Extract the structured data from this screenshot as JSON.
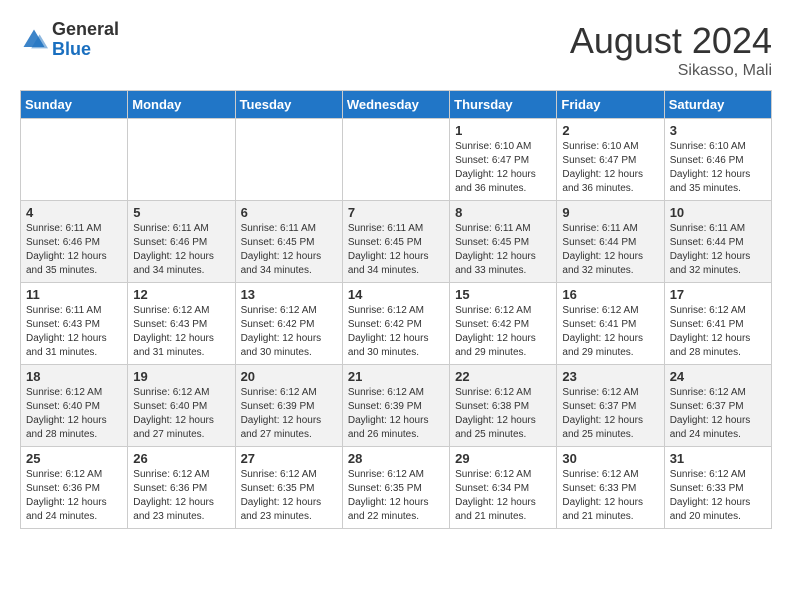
{
  "header": {
    "logo_general": "General",
    "logo_blue": "Blue",
    "month_year": "August 2024",
    "location": "Sikasso, Mali"
  },
  "days_of_week": [
    "Sunday",
    "Monday",
    "Tuesday",
    "Wednesday",
    "Thursday",
    "Friday",
    "Saturday"
  ],
  "weeks": [
    [
      {
        "day": "",
        "sunrise": "",
        "sunset": "",
        "daylight": ""
      },
      {
        "day": "",
        "sunrise": "",
        "sunset": "",
        "daylight": ""
      },
      {
        "day": "",
        "sunrise": "",
        "sunset": "",
        "daylight": ""
      },
      {
        "day": "",
        "sunrise": "",
        "sunset": "",
        "daylight": ""
      },
      {
        "day": "1",
        "sunrise": "6:10 AM",
        "sunset": "6:47 PM",
        "daylight": "12 hours and 36 minutes."
      },
      {
        "day": "2",
        "sunrise": "6:10 AM",
        "sunset": "6:47 PM",
        "daylight": "12 hours and 36 minutes."
      },
      {
        "day": "3",
        "sunrise": "6:10 AM",
        "sunset": "6:46 PM",
        "daylight": "12 hours and 35 minutes."
      }
    ],
    [
      {
        "day": "4",
        "sunrise": "6:11 AM",
        "sunset": "6:46 PM",
        "daylight": "12 hours and 35 minutes."
      },
      {
        "day": "5",
        "sunrise": "6:11 AM",
        "sunset": "6:46 PM",
        "daylight": "12 hours and 34 minutes."
      },
      {
        "day": "6",
        "sunrise": "6:11 AM",
        "sunset": "6:45 PM",
        "daylight": "12 hours and 34 minutes."
      },
      {
        "day": "7",
        "sunrise": "6:11 AM",
        "sunset": "6:45 PM",
        "daylight": "12 hours and 34 minutes."
      },
      {
        "day": "8",
        "sunrise": "6:11 AM",
        "sunset": "6:45 PM",
        "daylight": "12 hours and 33 minutes."
      },
      {
        "day": "9",
        "sunrise": "6:11 AM",
        "sunset": "6:44 PM",
        "daylight": "12 hours and 32 minutes."
      },
      {
        "day": "10",
        "sunrise": "6:11 AM",
        "sunset": "6:44 PM",
        "daylight": "12 hours and 32 minutes."
      }
    ],
    [
      {
        "day": "11",
        "sunrise": "6:11 AM",
        "sunset": "6:43 PM",
        "daylight": "12 hours and 31 minutes."
      },
      {
        "day": "12",
        "sunrise": "6:12 AM",
        "sunset": "6:43 PM",
        "daylight": "12 hours and 31 minutes."
      },
      {
        "day": "13",
        "sunrise": "6:12 AM",
        "sunset": "6:42 PM",
        "daylight": "12 hours and 30 minutes."
      },
      {
        "day": "14",
        "sunrise": "6:12 AM",
        "sunset": "6:42 PM",
        "daylight": "12 hours and 30 minutes."
      },
      {
        "day": "15",
        "sunrise": "6:12 AM",
        "sunset": "6:42 PM",
        "daylight": "12 hours and 29 minutes."
      },
      {
        "day": "16",
        "sunrise": "6:12 AM",
        "sunset": "6:41 PM",
        "daylight": "12 hours and 29 minutes."
      },
      {
        "day": "17",
        "sunrise": "6:12 AM",
        "sunset": "6:41 PM",
        "daylight": "12 hours and 28 minutes."
      }
    ],
    [
      {
        "day": "18",
        "sunrise": "6:12 AM",
        "sunset": "6:40 PM",
        "daylight": "12 hours and 28 minutes."
      },
      {
        "day": "19",
        "sunrise": "6:12 AM",
        "sunset": "6:40 PM",
        "daylight": "12 hours and 27 minutes."
      },
      {
        "day": "20",
        "sunrise": "6:12 AM",
        "sunset": "6:39 PM",
        "daylight": "12 hours and 27 minutes."
      },
      {
        "day": "21",
        "sunrise": "6:12 AM",
        "sunset": "6:39 PM",
        "daylight": "12 hours and 26 minutes."
      },
      {
        "day": "22",
        "sunrise": "6:12 AM",
        "sunset": "6:38 PM",
        "daylight": "12 hours and 25 minutes."
      },
      {
        "day": "23",
        "sunrise": "6:12 AM",
        "sunset": "6:37 PM",
        "daylight": "12 hours and 25 minutes."
      },
      {
        "day": "24",
        "sunrise": "6:12 AM",
        "sunset": "6:37 PM",
        "daylight": "12 hours and 24 minutes."
      }
    ],
    [
      {
        "day": "25",
        "sunrise": "6:12 AM",
        "sunset": "6:36 PM",
        "daylight": "12 hours and 24 minutes."
      },
      {
        "day": "26",
        "sunrise": "6:12 AM",
        "sunset": "6:36 PM",
        "daylight": "12 hours and 23 minutes."
      },
      {
        "day": "27",
        "sunrise": "6:12 AM",
        "sunset": "6:35 PM",
        "daylight": "12 hours and 23 minutes."
      },
      {
        "day": "28",
        "sunrise": "6:12 AM",
        "sunset": "6:35 PM",
        "daylight": "12 hours and 22 minutes."
      },
      {
        "day": "29",
        "sunrise": "6:12 AM",
        "sunset": "6:34 PM",
        "daylight": "12 hours and 21 minutes."
      },
      {
        "day": "30",
        "sunrise": "6:12 AM",
        "sunset": "6:33 PM",
        "daylight": "12 hours and 21 minutes."
      },
      {
        "day": "31",
        "sunrise": "6:12 AM",
        "sunset": "6:33 PM",
        "daylight": "12 hours and 20 minutes."
      }
    ]
  ]
}
